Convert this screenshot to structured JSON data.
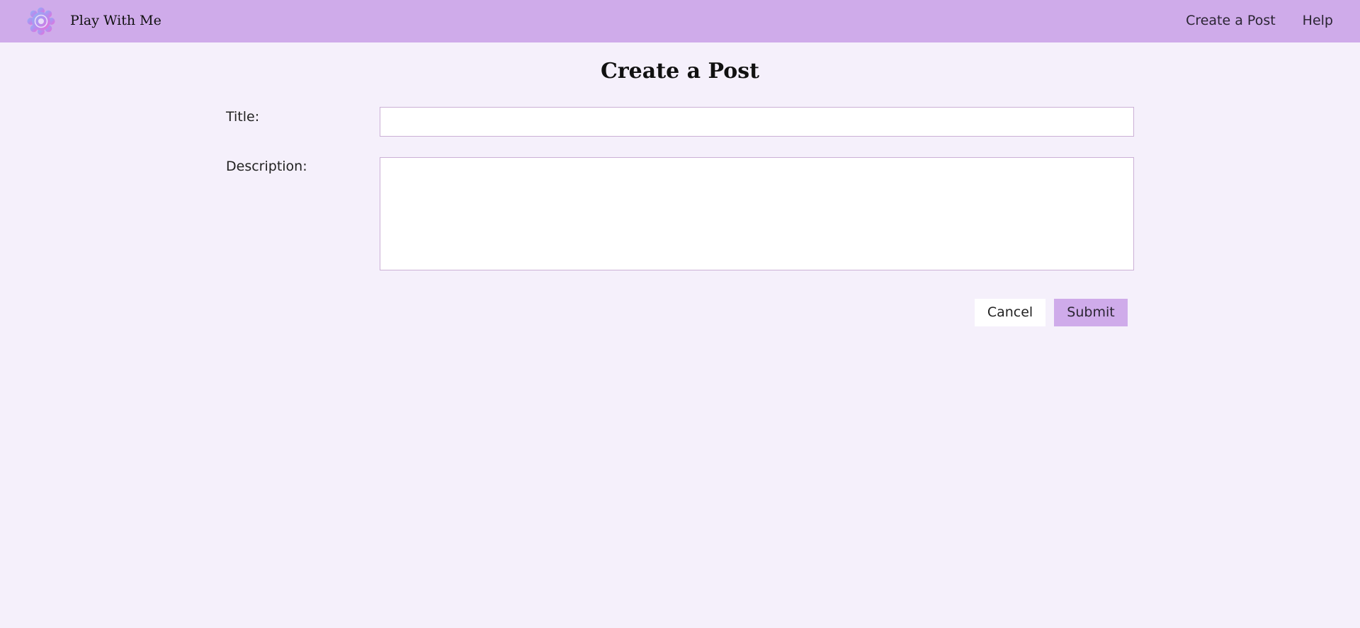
{
  "header": {
    "brand": "Play With Me",
    "logo_icon": "flower-icon",
    "nav": [
      {
        "label": "Create a Post"
      },
      {
        "label": "Help"
      }
    ]
  },
  "form": {
    "title": "Create a Post",
    "title_label": "Title:",
    "title_value": "",
    "description_label": "Description:",
    "description_value": "",
    "cancel_label": "Cancel",
    "submit_label": "Submit"
  },
  "colors": {
    "header_bg": "#cfabea",
    "page_bg": "#f5f0fb",
    "submit_bg": "#cfabea",
    "input_border": "#cbb0d6"
  }
}
